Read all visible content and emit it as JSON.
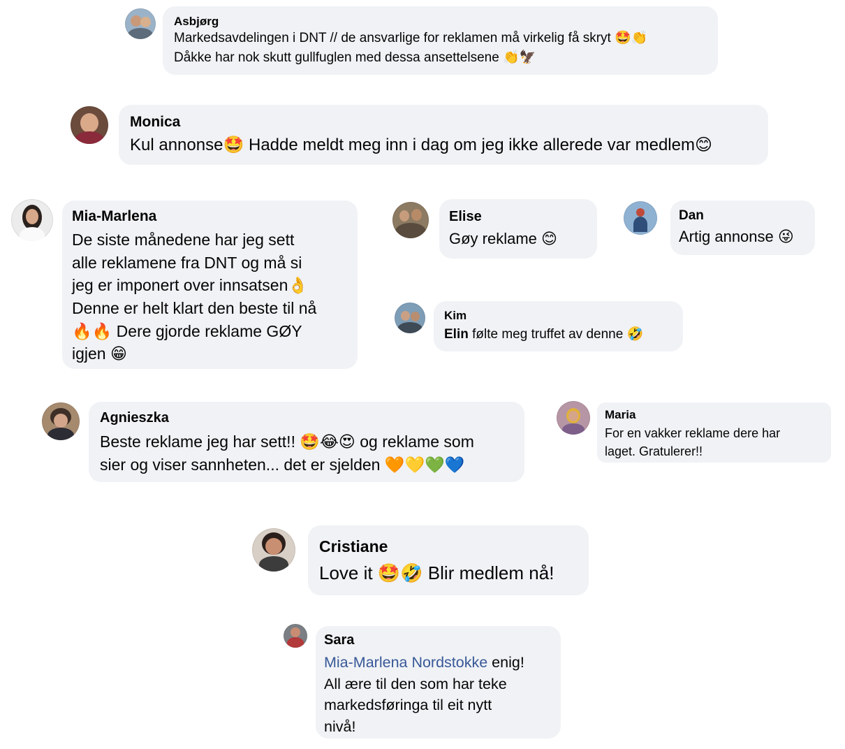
{
  "colors": {
    "bubble": "#f0f2f5",
    "text": "#050505",
    "mention": "#385898"
  },
  "comments": [
    {
      "name": "Asbjørg",
      "avatar_icon": "user-avatar-icon",
      "text": "Markedsavdelingen i DNT // de ansvarlige for reklamen må virkelig få skryt 🤩👏\nDåkke har nok skutt gullfuglen med dessa ansettelsene 👏🦅"
    },
    {
      "name": "Monica",
      "avatar_icon": "user-avatar-icon",
      "text": "Kul annonse🤩 Hadde meldt meg inn i dag om jeg ikke allerede var medlem😊"
    },
    {
      "name": "Mia-Marlena",
      "avatar_icon": "user-avatar-icon",
      "text": "De siste månedene har jeg sett\nalle reklamene fra DNT og må si\njeg er imponert over innsatsen👌\nDenne er helt klart den beste til nå\n🔥🔥 Dere gjorde reklame GØY\nigjen 😁"
    },
    {
      "name": "Elise",
      "avatar_icon": "user-avatar-icon",
      "text": "Gøy reklame 😊"
    },
    {
      "name": "Dan",
      "avatar_icon": "user-avatar-icon",
      "text": "Artig annonse 😜"
    },
    {
      "name": "Kim",
      "avatar_icon": "user-avatar-icon",
      "tag": "Elin",
      "text": " følte meg truffet av denne 🤣"
    },
    {
      "name": "Agnieszka",
      "avatar_icon": "user-avatar-icon",
      "text": "Beste reklame jeg har sett!! 🤩😂😍 og reklame som\nsier og viser sannheten... det er sjelden 🧡💛💚💙"
    },
    {
      "name": "Maria",
      "avatar_icon": "user-avatar-icon",
      "text": "For en vakker reklame dere har\nlaget. Gratulerer!!"
    },
    {
      "name": "Cristiane",
      "avatar_icon": "user-avatar-icon",
      "text": "Love it 🤩🤣 Blir medlem nå!"
    },
    {
      "name": "Sara",
      "avatar_icon": "user-avatar-icon",
      "mention": "Mia-Marlena Nordstokke",
      "text": " enig!\nAll ære til den som har teke\nmarkedsføringa til eit nytt\nnivå!"
    }
  ]
}
